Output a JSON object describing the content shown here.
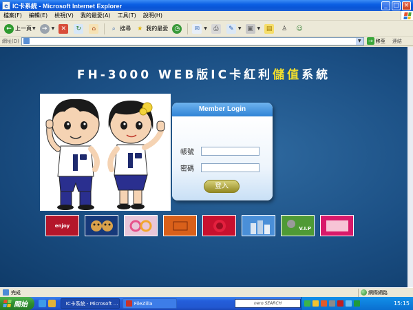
{
  "window": {
    "title": "IC卡系統 - Microsoft Internet Explorer",
    "minimize_glyph": "_",
    "maximize_glyph": "□",
    "close_glyph": "×"
  },
  "menu": {
    "items": [
      "檔案(F)",
      "編輯(E)",
      "檢視(V)",
      "我的最愛(A)",
      "工具(T)",
      "說明(H)"
    ]
  },
  "toolbar": {
    "back_label": "上一頁",
    "search_label": "搜尋",
    "favorites_label": "我的最愛"
  },
  "address": {
    "label": "網址(D)",
    "value": "",
    "go_label": "移至",
    "links_label": "連結"
  },
  "page": {
    "title_plain": "FH-3000 WEB版IC卡紅利",
    "title_highlight": [
      "儲",
      "值"
    ],
    "title_end": [
      "系",
      "統"
    ]
  },
  "login": {
    "header": "Member Login",
    "account_label": "帳號",
    "password_label": "密碼",
    "submit_label": "登入"
  },
  "cards": [
    {
      "label": "enjoy",
      "color": "#b4162a"
    },
    {
      "label": "",
      "color": "#16397a"
    },
    {
      "label": "",
      "color": "#e8c6d9"
    },
    {
      "label": "",
      "color": "#d9601a"
    },
    {
      "label": "",
      "color": "#c8102e"
    },
    {
      "label": "",
      "color": "#4a8fd8"
    },
    {
      "label": "V.I.P",
      "color": "#4f9a35"
    },
    {
      "label": "",
      "color": "#d8196a"
    }
  ],
  "status": {
    "text": "完成",
    "zone": "網際網路"
  },
  "taskbar": {
    "start_label": "開始",
    "tasks": [
      "IC卡系統 - Microsoft ...",
      "FileZilla"
    ],
    "nero_label": "nero SEARCH",
    "clock": "15:15"
  }
}
